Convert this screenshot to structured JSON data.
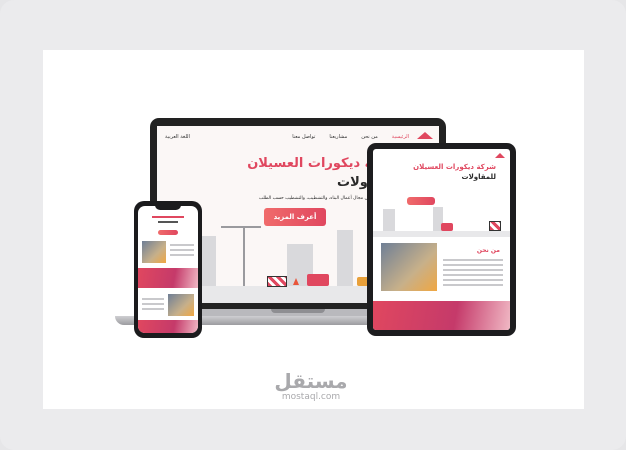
{
  "laptop": {
    "nav": [
      "الرئيسية",
      "من نحن",
      "مشاريعنا",
      "تواصل معنا",
      "اللغة العربية"
    ],
    "headline_line1": "شركة ديكورات العسيلان",
    "headline_line2": "للمقاولات",
    "description": "شركة متخصصة في مجال أعمال البناء، والتشطيب، والتشطيب حسب الطلب",
    "cta_label": "أعرف المزيد"
  },
  "tablet": {
    "headline_line1": "شركة ديكورات العسيلان",
    "headline_line2": "للمقاولات",
    "about_heading": "من نحن"
  },
  "watermark": {
    "arabic": "مستقل",
    "latin": "mostaql.com"
  },
  "colors": {
    "accent": "#e0475f",
    "dark_text": "#2a2a2a"
  }
}
